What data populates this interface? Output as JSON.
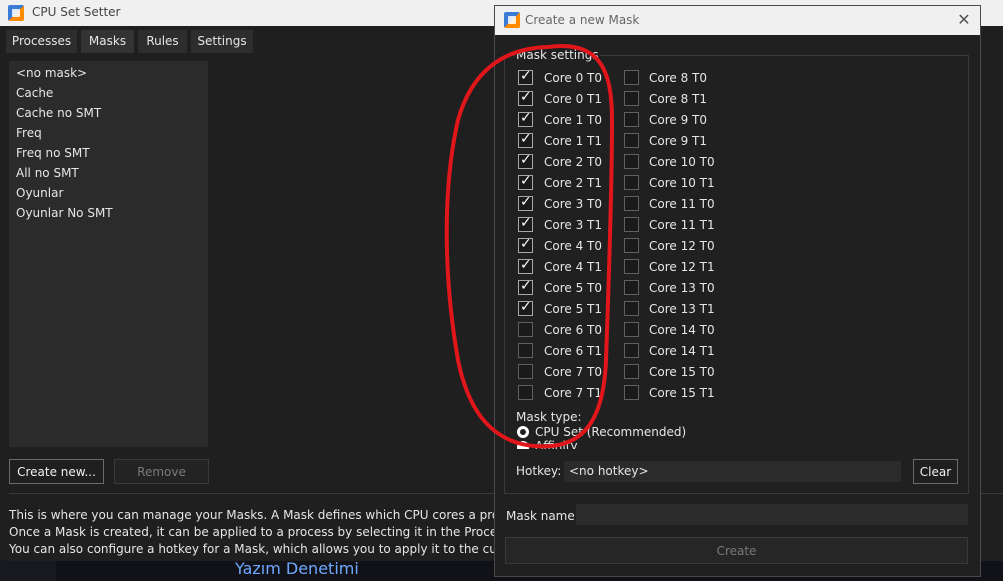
{
  "main_window": {
    "title": "CPU Set Setter",
    "tabs": [
      {
        "label": "Processes"
      },
      {
        "label": "Masks"
      },
      {
        "label": "Rules"
      },
      {
        "label": "Settings"
      }
    ],
    "masks": [
      "<no mask>",
      "Cache",
      "Cache no SMT",
      "Freq",
      "Freq no SMT",
      "All no SMT",
      "Oyunlar",
      "Oyunlar No SMT"
    ],
    "create_new_label": "Create new...",
    "remove_label": "Remove",
    "info_lines": [
      "This is where you can manage your Masks. A Mask defines which CPU cores a process can ru",
      "Once a Mask is created, it can be applied to a process by selecting it in the Processes tab.",
      "You can also configure a hotkey for a Mask, which allows you to apply it to the current foreg"
    ]
  },
  "background_text": "Yazım Denetimi",
  "dialog": {
    "title": "Create a new Mask",
    "mask_settings_label": "Mask settings",
    "cores_left": [
      {
        "label": "Core 0 T0",
        "checked": true
      },
      {
        "label": "Core 0 T1",
        "checked": true
      },
      {
        "label": "Core 1 T0",
        "checked": true
      },
      {
        "label": "Core 1 T1",
        "checked": true
      },
      {
        "label": "Core 2 T0",
        "checked": true
      },
      {
        "label": "Core 2 T1",
        "checked": true
      },
      {
        "label": "Core 3 T0",
        "checked": true
      },
      {
        "label": "Core 3 T1",
        "checked": true
      },
      {
        "label": "Core 4 T0",
        "checked": true
      },
      {
        "label": "Core 4 T1",
        "checked": true
      },
      {
        "label": "Core 5 T0",
        "checked": true
      },
      {
        "label": "Core 5 T1",
        "checked": true
      },
      {
        "label": "Core 6 T0",
        "checked": false
      },
      {
        "label": "Core 6 T1",
        "checked": false
      },
      {
        "label": "Core 7 T0",
        "checked": false
      },
      {
        "label": "Core 7 T1",
        "checked": false
      }
    ],
    "cores_right": [
      {
        "label": "Core 8 T0",
        "checked": false
      },
      {
        "label": "Core 8 T1",
        "checked": false
      },
      {
        "label": "Core 9 T0",
        "checked": false
      },
      {
        "label": "Core 9 T1",
        "checked": false
      },
      {
        "label": "Core 10 T0",
        "checked": false
      },
      {
        "label": "Core 10 T1",
        "checked": false
      },
      {
        "label": "Core 11 T0",
        "checked": false
      },
      {
        "label": "Core 11 T1",
        "checked": false
      },
      {
        "label": "Core 12 T0",
        "checked": false
      },
      {
        "label": "Core 12 T1",
        "checked": false
      },
      {
        "label": "Core 13 T0",
        "checked": false
      },
      {
        "label": "Core 13 T1",
        "checked": false
      },
      {
        "label": "Core 14 T0",
        "checked": false
      },
      {
        "label": "Core 14 T1",
        "checked": false
      },
      {
        "label": "Core 15 T0",
        "checked": false
      },
      {
        "label": "Core 15 T1",
        "checked": false
      }
    ],
    "mask_type_label": "Mask type:",
    "mask_type_options": [
      {
        "label": "CPU Set (Recommended)",
        "selected": true
      },
      {
        "label": "Affinity",
        "selected": false
      }
    ],
    "hotkey_label": "Hotkey:",
    "hotkey_value": "<no hotkey>",
    "clear_label": "Clear",
    "mask_name_label": "Mask name:",
    "mask_name_value": "",
    "create_label": "Create"
  },
  "colors": {
    "annotation": "#e0161b",
    "accent_icon_blue": "#3a7bd5",
    "accent_icon_orange": "#ff8a00"
  }
}
